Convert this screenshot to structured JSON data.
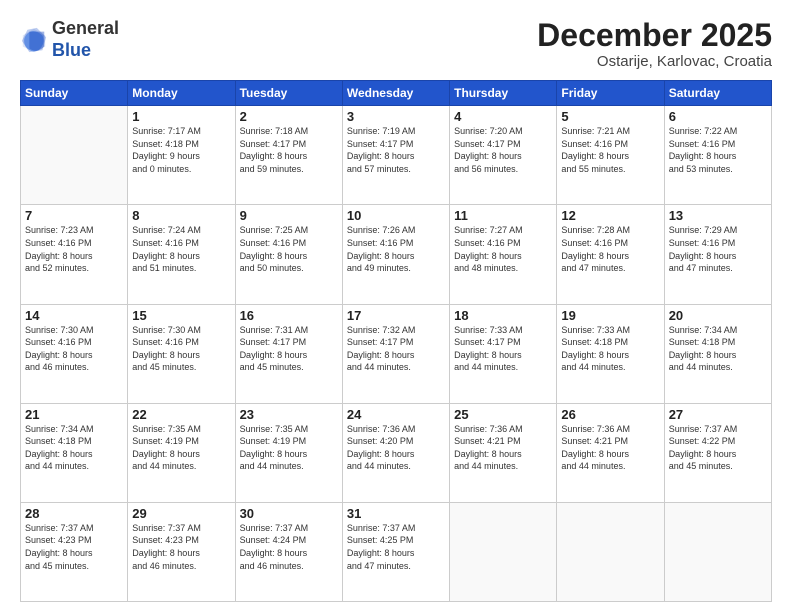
{
  "header": {
    "logo_general": "General",
    "logo_blue": "Blue",
    "month": "December 2025",
    "location": "Ostarije, Karlovac, Croatia"
  },
  "days_of_week": [
    "Sunday",
    "Monday",
    "Tuesday",
    "Wednesday",
    "Thursday",
    "Friday",
    "Saturday"
  ],
  "weeks": [
    [
      {
        "day": "",
        "info": ""
      },
      {
        "day": "1",
        "info": "Sunrise: 7:17 AM\nSunset: 4:18 PM\nDaylight: 9 hours\nand 0 minutes."
      },
      {
        "day": "2",
        "info": "Sunrise: 7:18 AM\nSunset: 4:17 PM\nDaylight: 8 hours\nand 59 minutes."
      },
      {
        "day": "3",
        "info": "Sunrise: 7:19 AM\nSunset: 4:17 PM\nDaylight: 8 hours\nand 57 minutes."
      },
      {
        "day": "4",
        "info": "Sunrise: 7:20 AM\nSunset: 4:17 PM\nDaylight: 8 hours\nand 56 minutes."
      },
      {
        "day": "5",
        "info": "Sunrise: 7:21 AM\nSunset: 4:16 PM\nDaylight: 8 hours\nand 55 minutes."
      },
      {
        "day": "6",
        "info": "Sunrise: 7:22 AM\nSunset: 4:16 PM\nDaylight: 8 hours\nand 53 minutes."
      }
    ],
    [
      {
        "day": "7",
        "info": "Sunrise: 7:23 AM\nSunset: 4:16 PM\nDaylight: 8 hours\nand 52 minutes."
      },
      {
        "day": "8",
        "info": "Sunrise: 7:24 AM\nSunset: 4:16 PM\nDaylight: 8 hours\nand 51 minutes."
      },
      {
        "day": "9",
        "info": "Sunrise: 7:25 AM\nSunset: 4:16 PM\nDaylight: 8 hours\nand 50 minutes."
      },
      {
        "day": "10",
        "info": "Sunrise: 7:26 AM\nSunset: 4:16 PM\nDaylight: 8 hours\nand 49 minutes."
      },
      {
        "day": "11",
        "info": "Sunrise: 7:27 AM\nSunset: 4:16 PM\nDaylight: 8 hours\nand 48 minutes."
      },
      {
        "day": "12",
        "info": "Sunrise: 7:28 AM\nSunset: 4:16 PM\nDaylight: 8 hours\nand 47 minutes."
      },
      {
        "day": "13",
        "info": "Sunrise: 7:29 AM\nSunset: 4:16 PM\nDaylight: 8 hours\nand 47 minutes."
      }
    ],
    [
      {
        "day": "14",
        "info": "Sunrise: 7:30 AM\nSunset: 4:16 PM\nDaylight: 8 hours\nand 46 minutes."
      },
      {
        "day": "15",
        "info": "Sunrise: 7:30 AM\nSunset: 4:16 PM\nDaylight: 8 hours\nand 45 minutes."
      },
      {
        "day": "16",
        "info": "Sunrise: 7:31 AM\nSunset: 4:17 PM\nDaylight: 8 hours\nand 45 minutes."
      },
      {
        "day": "17",
        "info": "Sunrise: 7:32 AM\nSunset: 4:17 PM\nDaylight: 8 hours\nand 44 minutes."
      },
      {
        "day": "18",
        "info": "Sunrise: 7:33 AM\nSunset: 4:17 PM\nDaylight: 8 hours\nand 44 minutes."
      },
      {
        "day": "19",
        "info": "Sunrise: 7:33 AM\nSunset: 4:18 PM\nDaylight: 8 hours\nand 44 minutes."
      },
      {
        "day": "20",
        "info": "Sunrise: 7:34 AM\nSunset: 4:18 PM\nDaylight: 8 hours\nand 44 minutes."
      }
    ],
    [
      {
        "day": "21",
        "info": "Sunrise: 7:34 AM\nSunset: 4:18 PM\nDaylight: 8 hours\nand 44 minutes."
      },
      {
        "day": "22",
        "info": "Sunrise: 7:35 AM\nSunset: 4:19 PM\nDaylight: 8 hours\nand 44 minutes."
      },
      {
        "day": "23",
        "info": "Sunrise: 7:35 AM\nSunset: 4:19 PM\nDaylight: 8 hours\nand 44 minutes."
      },
      {
        "day": "24",
        "info": "Sunrise: 7:36 AM\nSunset: 4:20 PM\nDaylight: 8 hours\nand 44 minutes."
      },
      {
        "day": "25",
        "info": "Sunrise: 7:36 AM\nSunset: 4:21 PM\nDaylight: 8 hours\nand 44 minutes."
      },
      {
        "day": "26",
        "info": "Sunrise: 7:36 AM\nSunset: 4:21 PM\nDaylight: 8 hours\nand 44 minutes."
      },
      {
        "day": "27",
        "info": "Sunrise: 7:37 AM\nSunset: 4:22 PM\nDaylight: 8 hours\nand 45 minutes."
      }
    ],
    [
      {
        "day": "28",
        "info": "Sunrise: 7:37 AM\nSunset: 4:23 PM\nDaylight: 8 hours\nand 45 minutes."
      },
      {
        "day": "29",
        "info": "Sunrise: 7:37 AM\nSunset: 4:23 PM\nDaylight: 8 hours\nand 46 minutes."
      },
      {
        "day": "30",
        "info": "Sunrise: 7:37 AM\nSunset: 4:24 PM\nDaylight: 8 hours\nand 46 minutes."
      },
      {
        "day": "31",
        "info": "Sunrise: 7:37 AM\nSunset: 4:25 PM\nDaylight: 8 hours\nand 47 minutes."
      },
      {
        "day": "",
        "info": ""
      },
      {
        "day": "",
        "info": ""
      },
      {
        "day": "",
        "info": ""
      }
    ]
  ]
}
